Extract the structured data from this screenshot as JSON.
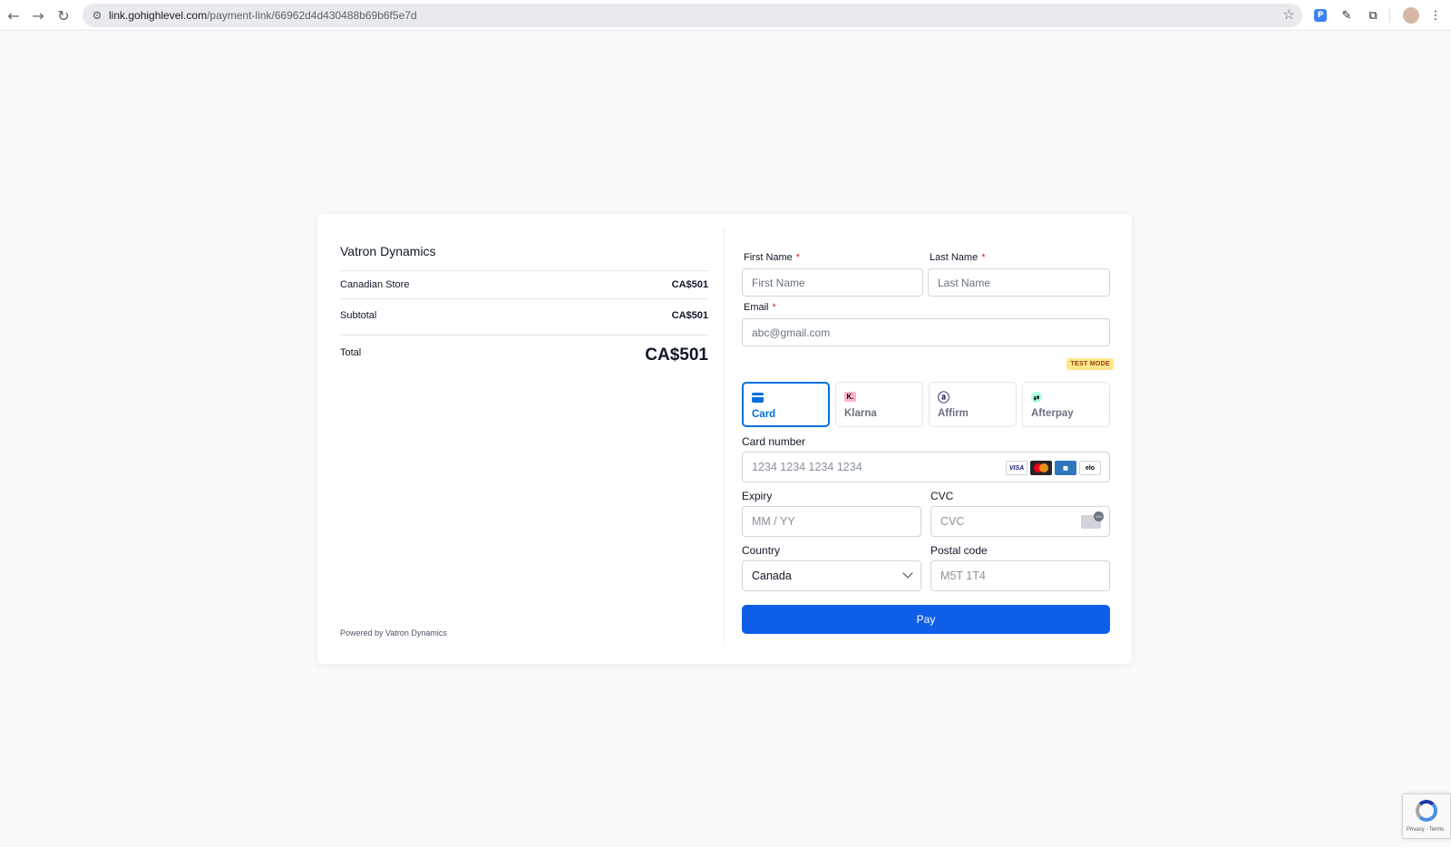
{
  "browser": {
    "url_host": "link.gohighlevel.com",
    "url_path": "/payment-link/66962d4d430488b69b6f5e7d"
  },
  "summary": {
    "merchant": "Vatron Dynamics",
    "line_item": {
      "name": "Canadian Store",
      "amount": "CA$501"
    },
    "subtotal": {
      "label": "Subtotal",
      "amount": "CA$501"
    },
    "total": {
      "label": "Total",
      "amount": "CA$501"
    },
    "powered_by": "Powered by Vatron Dynamics"
  },
  "form": {
    "first_name": {
      "label": "First Name",
      "required": "*",
      "placeholder": "First Name"
    },
    "last_name": {
      "label": "Last Name",
      "required": "*",
      "placeholder": "Last Name"
    },
    "email": {
      "label": "Email",
      "required": "*",
      "placeholder": "abc@gmail.com"
    },
    "test_mode_badge": "TEST MODE",
    "payment_tabs": [
      {
        "label": "Card",
        "icon": "credit-card-icon",
        "active": true
      },
      {
        "label": "Klarna",
        "icon": "klarna-icon",
        "active": false
      },
      {
        "label": "Affirm",
        "icon": "affirm-icon",
        "active": false
      },
      {
        "label": "Afterpay",
        "icon": "afterpay-icon",
        "active": false
      }
    ],
    "card_number": {
      "label": "Card number",
      "placeholder": "1234 1234 1234 1234"
    },
    "card_brands": [
      "VISA",
      "elo"
    ],
    "expiry": {
      "label": "Expiry",
      "placeholder": "MM / YY"
    },
    "cvc": {
      "label": "CVC",
      "placeholder": "CVC"
    },
    "country": {
      "label": "Country",
      "value": "Canada"
    },
    "postal_code": {
      "label": "Postal code",
      "placeholder": "M5T 1T4"
    },
    "pay_button": "Pay"
  },
  "recaptcha": {
    "text": "Privacy - Terms"
  },
  "colors": {
    "accent": "#0570de",
    "pay_button": "#0f5ee8",
    "badge": "#fde68a",
    "required": "#dc2626"
  }
}
